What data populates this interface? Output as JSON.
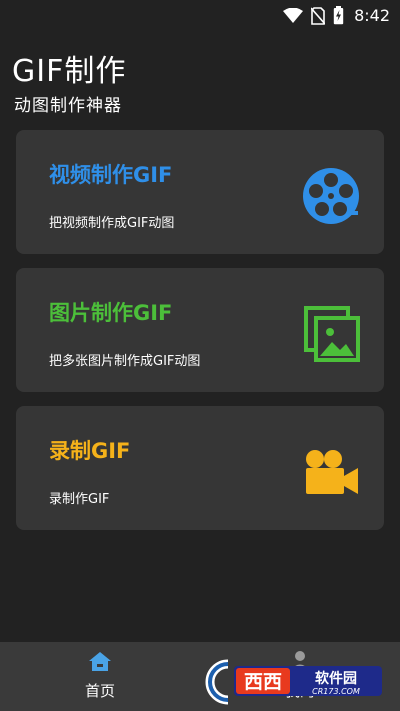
{
  "status_bar": {
    "time": "8:42"
  },
  "header": {
    "title": "GIF制作",
    "subtitle": "动图制作神器"
  },
  "cards": [
    {
      "title": "视频制作GIF",
      "desc": "把视频制作成GIF动图",
      "color": "#2f8fe8",
      "icon": "film-reel-icon"
    },
    {
      "title": "图片制作GIF",
      "desc": "把多张图片制作成GIF动图",
      "color": "#4cbf3a",
      "icon": "image-gallery-icon"
    },
    {
      "title": "录制GIF",
      "desc": "录制作GIF",
      "color": "#f5b21a",
      "icon": "video-camera-icon"
    }
  ],
  "bottom_nav": [
    {
      "label": "首页",
      "icon": "home-icon",
      "active": true
    },
    {
      "label": "我的",
      "icon": "person-icon",
      "active": false
    }
  ],
  "watermark": {
    "text": "西西软件园",
    "url_text": "CR173.COM"
  }
}
